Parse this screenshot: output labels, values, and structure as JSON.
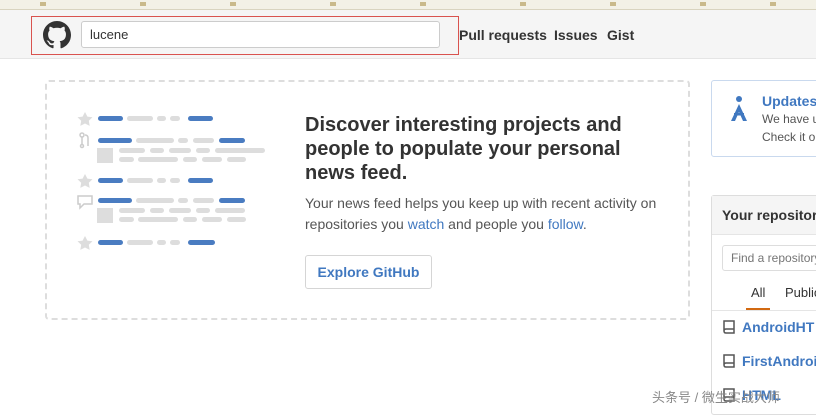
{
  "header": {
    "search_value": "lucene",
    "nav": [
      "Pull requests",
      "Issues",
      "Gist"
    ]
  },
  "feed": {
    "title": "Discover interesting projects and people to populate your personal news feed.",
    "desc_before": "Your news feed helps you keep up with recent activity on repositories you ",
    "watch_link": "watch",
    "desc_middle": " and people you ",
    "follow_link": "follow",
    "desc_end": ".",
    "explore_label": "Explore GitHub"
  },
  "updates": {
    "title": "Updates",
    "line1": "We have u",
    "line2": "Check it o"
  },
  "repos": {
    "title": "Your repositor",
    "find_placeholder": "Find a repository",
    "tabs": [
      "All",
      "Public"
    ],
    "items": [
      "AndroidHT",
      "FirstAndroi",
      "HTML"
    ]
  },
  "colors": {
    "link": "#4078c0",
    "accent": "#d26911"
  },
  "icons": [
    "github-logo-icon",
    "star-icon",
    "pull-request-icon",
    "comment-icon",
    "broadcast-icon",
    "repo-icon"
  ],
  "watermark": "头条号 / 微生实战大师"
}
